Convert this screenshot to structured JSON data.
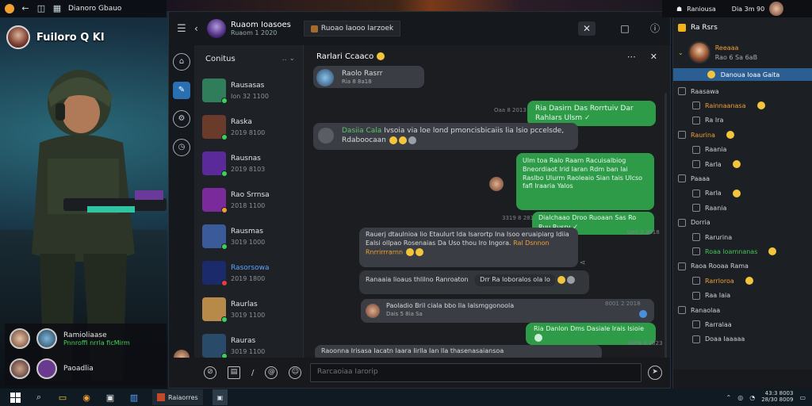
{
  "background_app": {
    "window_title": "Dianoro Gbauo",
    "profile_name": "Fuiloro Q KI",
    "friends": [
      {
        "name": "Ramioliaase",
        "status": "Pnnroffi nrrla ficMirm",
        "avatar_color": "#d7b49a"
      },
      {
        "name": "Paoadlia",
        "status": "",
        "avatar_color": "#6a3a8f"
      }
    ]
  },
  "chat_window": {
    "title_name": "Ruaom Ioasoes",
    "title_sub": "Ruaom 1 2020",
    "status_chip": "Ruoao Iaooo Iarzoek",
    "contacts_header": "Conitus",
    "contacts": [
      {
        "name": "Rausasas",
        "sub": "Ion 32 1100",
        "color": "#2f7d5a",
        "status": "#3ad15a"
      },
      {
        "name": "Raska",
        "sub": "2019 8100",
        "color": "#6a3a2a",
        "status": "#3ad15a"
      },
      {
        "name": "Rausnas",
        "sub": "2019 8103",
        "color": "#5a2a9a",
        "status": "#3ad15a"
      },
      {
        "name": "Rao Srrnsa",
        "sub": "2018 1100",
        "color": "#7a2a9a",
        "status": "#f0a035"
      },
      {
        "name": "Rausmas",
        "sub": "3019 1000",
        "color": "#3a5a9a",
        "status": "#3ad15a"
      },
      {
        "name": "Rasorsowa",
        "sub": "2019 1800",
        "color": "#1a2a6a",
        "status": "#e04040",
        "accent": true
      },
      {
        "name": "Raurlas",
        "sub": "3019 1100",
        "color": "#b88a4a",
        "status": "#3ad15a"
      },
      {
        "name": "Rauras",
        "sub": "3019 1100",
        "color": "#2a4a6a",
        "status": "#3ad15a"
      }
    ],
    "conversation_title": "Rarlari Ccaaco",
    "messages": {
      "m1_name": "Raolo Rasrr",
      "m1_sub": "Ria 8 8a18",
      "m2": "Ria Dasirn Das Rorrtuiv Dar Rahlars Ulsm",
      "m3_lead": "Dasiia Cala",
      "m3_body": "Ivsoia via loe lond pmoncisbicaiis lia lsio pccelsde,",
      "m3_tail": "Rdaboocaan",
      "m4": "Ulm toa Ralo Raarn Racuisalbiog Bneordiaot lrid Iaran Rdm ban lai Raslbo Ulurm Raoleaio Sian tais Ulcso fafl Iraaria Yalos",
      "m5": "Dialchaao Droo Ruoaan Sas Ro Ruu Rusrv",
      "m6_body": "Rauerj dtaulnioa lio Etaulurt Ida Isarortp Ina Isoo eruaipiarg ldiia Ealsi ollpao Rosenaias Da Uso thou lro Ingora.",
      "m6_hl": "Ral Dsnnon Rnrrirrrarnn",
      "m7": "Ranaaia lioaus thlilno Ranroaton",
      "m7_chip": "Drr Ra loboralos ola lo",
      "m8": "Paoladio Bril ciala bbo Ila Ialsmggonoola",
      "m8_sub": "Dais 5 8ia Sa",
      "m9": "Ria Danlon Dms Dasiale Irais Isioie",
      "m10": "Raoonna Irisasa Iacatn laara Iirlla Ian lla thasenasaiansoa"
    },
    "times": [
      "Oaa 8 2013",
      "3319 8 2833",
      "Unn 3 3018",
      "8001 2 2018",
      "3009 3 2023",
      "2030 2028"
    ],
    "composer_placeholder": "Rarcaoiaa Iarorip"
  },
  "friends_panel": {
    "top_label": "Raniousa",
    "top_sub": "Dia 3m 90",
    "title": "Ra Rsrs",
    "me_name": "Reeaaa",
    "me_sub": "Rao 6 Sa 6aB",
    "banner": "Danoua Ioaa Gaita",
    "rows": [
      {
        "label": "Raasawa",
        "cls": ""
      },
      {
        "label": "Rainnaanasa",
        "cls": "o"
      },
      {
        "label": "Ra Ira",
        "cls": ""
      },
      {
        "label": "Raurina",
        "cls": "o"
      },
      {
        "label": "Raania",
        "cls": ""
      },
      {
        "label": "Rarla",
        "cls": ""
      },
      {
        "label": "Paaaa",
        "cls": ""
      },
      {
        "label": "Rarla",
        "cls": ""
      },
      {
        "label": "Raania",
        "cls": ""
      },
      {
        "label": "Dorria",
        "cls": ""
      },
      {
        "label": "Rarurina",
        "cls": ""
      },
      {
        "label": "Roaa loamnanas",
        "cls": "g"
      },
      {
        "label": "Raoa Rooaa Rama",
        "cls": ""
      },
      {
        "label": "Rarrloroa",
        "cls": "o"
      },
      {
        "label": "Raa Iaia",
        "cls": ""
      },
      {
        "label": "Ranaolaa",
        "cls": ""
      },
      {
        "label": "Rarralaa",
        "cls": ""
      },
      {
        "label": "Doaa Iaaaaa",
        "cls": ""
      }
    ]
  },
  "taskbar": {
    "app1": "Raiaorres",
    "time": "43:3 8003",
    "date": "28/30 8009"
  },
  "colors": {
    "accent": "#2b6fb3",
    "outgoing_bubble": "#2e9b49",
    "incoming_bubble": "#3a3d43",
    "highlight_orange": "#f0a035"
  }
}
